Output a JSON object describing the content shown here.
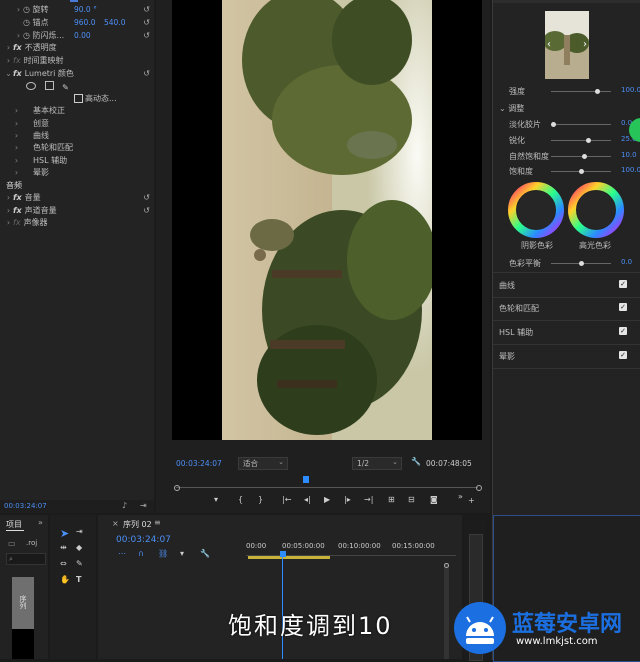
{
  "effect_controls": {
    "rows": [
      {
        "label": "旋转",
        "value": "90.0 °"
      },
      {
        "label": "锚点",
        "value": "960.0",
        "value2": "540.0"
      },
      {
        "label": "防闪烁...",
        "value": "0.00"
      },
      {
        "label": "不透明度"
      },
      {
        "label": "时间重映射"
      },
      {
        "label": "Lumetri 颜色"
      },
      {
        "checkbox_label": "高动态..."
      },
      {
        "label": "基本校正"
      },
      {
        "label": "创意"
      },
      {
        "label": "曲线"
      },
      {
        "label": "色轮和匹配"
      },
      {
        "label": "HSL 辅助"
      },
      {
        "label": "晕影"
      }
    ],
    "audio_header": "音频",
    "audio_rows": [
      {
        "label": "音量"
      },
      {
        "label": "声道音量"
      },
      {
        "label": "声像器"
      }
    ],
    "timecode": "00:03:24:07"
  },
  "program_monitor": {
    "timecode": "00:03:24:07",
    "fit": "适合",
    "resolution": "1/2",
    "duration": "00:07:48:05"
  },
  "lumetri": {
    "creative": {
      "intensity_label": "强度",
      "intensity_value": "100.0",
      "adjust_header": "调整",
      "sliders": [
        {
          "label": "淡化胶片",
          "value": "0.0",
          "pos": 0.0
        },
        {
          "label": "锐化",
          "value": "25.0",
          "pos": 0.62
        },
        {
          "label": "自然饱和度",
          "value": "10.0",
          "pos": 0.56
        },
        {
          "label": "饱和度",
          "value": "100.0",
          "pos": 0.5
        }
      ],
      "wheel_shadow_label": "阴影色彩",
      "wheel_highlight_label": "高光色彩",
      "tint_balance_label": "色彩平衡",
      "tint_balance_value": "0.0"
    },
    "sections": [
      "曲线",
      "色轮和匹配",
      "HSL 辅助",
      "晕影"
    ]
  },
  "project_panel": {
    "tab": "项目",
    "item": ".roj",
    "bin_label": "序列"
  },
  "timeline": {
    "tab": "序列 02",
    "timecode": "00:03:24:07",
    "ruler": [
      "00:00",
      "00:05:00:00",
      "00:10:00:00",
      "00:15:00:00"
    ]
  },
  "caption": "饱和度调到10",
  "watermark": {
    "name": "蓝莓安卓网",
    "url": "www.lmkjst.com"
  },
  "colors": {
    "accent": "#4c8ff5",
    "playhead": "#2d8cff",
    "wm_blue": "#1b6fe0"
  }
}
